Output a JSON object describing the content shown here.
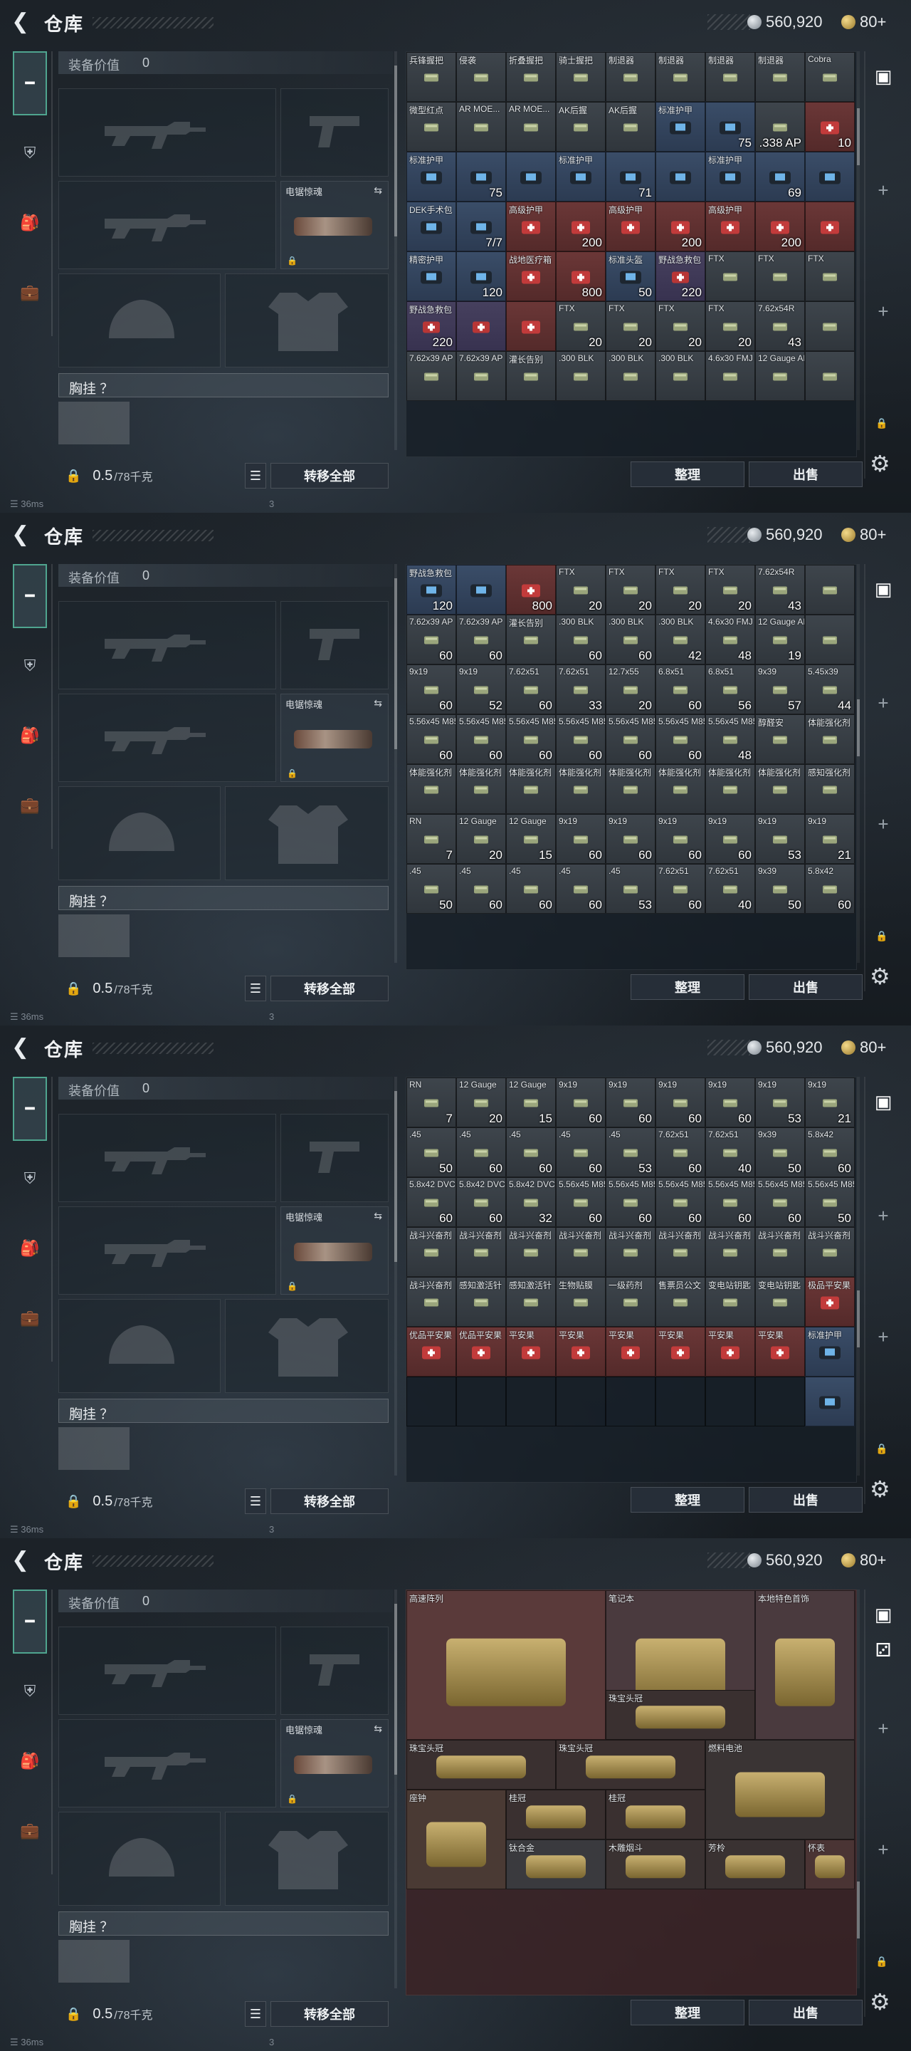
{
  "header": {
    "title": "仓库",
    "coins": "560,920",
    "level": "80+"
  },
  "equipment": {
    "value_label": "装备价值",
    "value": "0",
    "weapon_name": "电锯惊魂",
    "chest_label": "胸挂 ？",
    "weight_value": "0.5",
    "weight_unit": "/78千克",
    "transfer_all": "转移全部"
  },
  "actions": {
    "sort": "整理",
    "sell": "出售"
  },
  "status": {
    "ping": "36ms",
    "extra": "3"
  },
  "colors": {
    "accent": "#4fa58f",
    "rarity_blue": "#3a4d68",
    "rarity_red": "#6b3737",
    "rarity_purple": "#46405e",
    "rarity_gold": "#4b4436"
  },
  "panels": [
    {
      "rows": [
        [
          [
            "兵锋握把",
            "",
            "gray"
          ],
          [
            "侵袭",
            "",
            "gray"
          ],
          [
            "折叠握把",
            "",
            "gray"
          ],
          [
            "骑士握把",
            "",
            "gray"
          ],
          [
            "制退器",
            "",
            "gray"
          ],
          [
            "制退器",
            "",
            "gray"
          ],
          [
            "制退器",
            "",
            "gray"
          ],
          [
            "制退器",
            "",
            "gray"
          ],
          [
            "Cobra",
            "",
            "gray"
          ]
        ],
        [
          [
            "微型红点",
            "",
            "gray"
          ],
          [
            "AR MOE...",
            "",
            "gray"
          ],
          [
            "AR MOE...",
            "",
            "gray"
          ],
          [
            "AK后握",
            "",
            "gray"
          ],
          [
            "AK后握",
            "",
            "gray"
          ],
          [
            "标准护甲",
            "",
            "blue"
          ],
          [
            "",
            "75",
            "blue"
          ],
          [
            "",
            ".338 AP",
            "gray"
          ],
          [
            "",
            "10",
            "red"
          ]
        ],
        [
          [
            "标准护甲",
            "",
            "blue"
          ],
          [
            "",
            "75",
            "blue"
          ],
          [
            "",
            "",
            "blue"
          ],
          [
            "标准护甲",
            "",
            "blue"
          ],
          [
            "",
            "71",
            "blue"
          ],
          [
            "",
            "",
            "blue"
          ],
          [
            "标准护甲",
            "",
            "blue"
          ],
          [
            "",
            "69",
            "blue"
          ],
          [
            "",
            "",
            "blue"
          ]
        ],
        [
          [
            "DEK手术包",
            "",
            "blue"
          ],
          [
            "",
            "7/7",
            "blue"
          ],
          [
            "高级护甲",
            "",
            "red"
          ],
          [
            "",
            "200",
            "red"
          ],
          [
            "高级护甲",
            "",
            "red"
          ],
          [
            "",
            "200",
            "red"
          ],
          [
            "高级护甲",
            "",
            "red"
          ],
          [
            "",
            "200",
            "red"
          ],
          [
            "",
            "",
            "red"
          ]
        ],
        [
          [
            "精密护甲",
            "",
            "blue"
          ],
          [
            "",
            "120",
            "blue"
          ],
          [
            "战地医疗箱",
            "",
            "red"
          ],
          [
            "",
            "800",
            "red"
          ],
          [
            "标准头盔",
            "50",
            "blue"
          ],
          [
            "野战急救包",
            "220",
            "purple"
          ],
          [
            "FTX",
            "",
            "gray"
          ],
          [
            "FTX",
            "",
            "gray"
          ],
          [
            "FTX",
            "",
            "gray"
          ]
        ],
        [
          [
            "野战急救包",
            "220",
            "purple"
          ],
          [
            "",
            "",
            "purple"
          ],
          [
            "",
            "",
            "red"
          ],
          [
            "FTX",
            "20",
            "gray"
          ],
          [
            "FTX",
            "20",
            "gray"
          ],
          [
            "FTX",
            "20",
            "gray"
          ],
          [
            "FTX",
            "20",
            "gray"
          ],
          [
            "7.62x54R",
            "43",
            "gray"
          ],
          [
            "",
            "",
            "gray"
          ]
        ],
        [
          [
            "7.62x39 AP",
            "",
            "gray"
          ],
          [
            "7.62x39 AP",
            "",
            "gray"
          ],
          [
            "灌长告别",
            "",
            "gray"
          ],
          [
            ".300 BLK",
            "",
            "gray"
          ],
          [
            ".300 BLK",
            "",
            "gray"
          ],
          [
            ".300 BLK",
            "",
            "gray"
          ],
          [
            "4.6x30 FMJ",
            "",
            "gray"
          ],
          [
            "12 Gauge AP",
            "",
            "gray"
          ],
          [
            "",
            "",
            "gray"
          ]
        ]
      ]
    },
    {
      "rows": [
        [
          [
            "野战急救包",
            "120",
            "blue"
          ],
          [
            "",
            "",
            "blue"
          ],
          [
            "",
            "800",
            "red"
          ],
          [
            "FTX",
            "20",
            "gray"
          ],
          [
            "FTX",
            "20",
            "gray"
          ],
          [
            "FTX",
            "20",
            "gray"
          ],
          [
            "FTX",
            "20",
            "gray"
          ],
          [
            "7.62x54R",
            "43",
            "gray"
          ],
          [
            "",
            "",
            "gray"
          ]
        ],
        [
          [
            "7.62x39 AP",
            "60",
            "gray"
          ],
          [
            "7.62x39 AP",
            "60",
            "gray"
          ],
          [
            "灌长告别",
            "",
            "gray"
          ],
          [
            ".300 BLK",
            "60",
            "gray"
          ],
          [
            ".300 BLK",
            "60",
            "gray"
          ],
          [
            ".300 BLK",
            "42",
            "gray"
          ],
          [
            "4.6x30 FMJ",
            "48",
            "gray"
          ],
          [
            "12 Gauge AP",
            "19",
            "gray"
          ],
          [
            "",
            "",
            "gray"
          ]
        ],
        [
          [
            "9x19",
            "60",
            "gray"
          ],
          [
            "9x19",
            "52",
            "gray"
          ],
          [
            "7.62x51",
            "60",
            "gray"
          ],
          [
            "7.62x51",
            "33",
            "gray"
          ],
          [
            "12.7x55",
            "20",
            "gray"
          ],
          [
            "6.8x51",
            "60",
            "gray"
          ],
          [
            "6.8x51",
            "56",
            "gray"
          ],
          [
            "9x39",
            "57",
            "gray"
          ],
          [
            "5.45x39",
            "44",
            "gray"
          ]
        ],
        [
          [
            "5.56x45 M855A1",
            "60",
            "gray"
          ],
          [
            "5.56x45 M855A1",
            "60",
            "gray"
          ],
          [
            "5.56x45 M855A1",
            "60",
            "gray"
          ],
          [
            "5.56x45 M855A1",
            "60",
            "gray"
          ],
          [
            "5.56x45 M855A1",
            "60",
            "gray"
          ],
          [
            "5.56x45 M855A1",
            "60",
            "gray"
          ],
          [
            "5.56x45 M855A1",
            "48",
            "gray"
          ],
          [
            "醇醛安",
            "",
            "gray"
          ],
          [
            "体能强化剂",
            "",
            "gray"
          ]
        ],
        [
          [
            "体能强化剂",
            "",
            "gray"
          ],
          [
            "体能强化剂",
            "",
            "gray"
          ],
          [
            "体能强化剂",
            "",
            "gray"
          ],
          [
            "体能强化剂",
            "",
            "gray"
          ],
          [
            "体能强化剂",
            "",
            "gray"
          ],
          [
            "体能强化剂",
            "",
            "gray"
          ],
          [
            "体能强化剂",
            "",
            "gray"
          ],
          [
            "体能强化剂",
            "",
            "gray"
          ],
          [
            "感知强化剂",
            "",
            "gray"
          ]
        ],
        [
          [
            "RN",
            "7",
            "gray"
          ],
          [
            "12 Gauge",
            "20",
            "gray"
          ],
          [
            "12 Gauge",
            "15",
            "gray"
          ],
          [
            "9x19",
            "60",
            "gray"
          ],
          [
            "9x19",
            "60",
            "gray"
          ],
          [
            "9x19",
            "60",
            "gray"
          ],
          [
            "9x19",
            "60",
            "gray"
          ],
          [
            "9x19",
            "53",
            "gray"
          ],
          [
            "9x19",
            "21",
            "gray"
          ]
        ],
        [
          [
            ".45",
            "50",
            "gray"
          ],
          [
            ".45",
            "60",
            "gray"
          ],
          [
            ".45",
            "60",
            "gray"
          ],
          [
            ".45",
            "60",
            "gray"
          ],
          [
            ".45",
            "53",
            "gray"
          ],
          [
            "7.62x51",
            "60",
            "gray"
          ],
          [
            "7.62x51",
            "40",
            "gray"
          ],
          [
            "9x39",
            "50",
            "gray"
          ],
          [
            "5.8x42",
            "60",
            "gray"
          ]
        ]
      ]
    },
    {
      "rows": [
        [
          [
            "RN",
            "7",
            "gray"
          ],
          [
            "12 Gauge",
            "20",
            "gray"
          ],
          [
            "12 Gauge",
            "15",
            "gray"
          ],
          [
            "9x19",
            "60",
            "gray"
          ],
          [
            "9x19",
            "60",
            "gray"
          ],
          [
            "9x19",
            "60",
            "gray"
          ],
          [
            "9x19",
            "60",
            "gray"
          ],
          [
            "9x19",
            "53",
            "gray"
          ],
          [
            "9x19",
            "21",
            "gray"
          ]
        ],
        [
          [
            ".45",
            "50",
            "gray"
          ],
          [
            ".45",
            "60",
            "gray"
          ],
          [
            ".45",
            "60",
            "gray"
          ],
          [
            ".45",
            "60",
            "gray"
          ],
          [
            ".45",
            "53",
            "gray"
          ],
          [
            "7.62x51",
            "60",
            "gray"
          ],
          [
            "7.62x51",
            "40",
            "gray"
          ],
          [
            "9x39",
            "50",
            "gray"
          ],
          [
            "5.8x42",
            "60",
            "gray"
          ]
        ],
        [
          [
            "5.8x42 DVC",
            "60",
            "gray"
          ],
          [
            "5.8x42 DVC",
            "60",
            "gray"
          ],
          [
            "5.8x42 DVC",
            "32",
            "gray"
          ],
          [
            "5.56x45 M855",
            "60",
            "gray"
          ],
          [
            "5.56x45 M855",
            "60",
            "gray"
          ],
          [
            "5.56x45 M855",
            "60",
            "gray"
          ],
          [
            "5.56x45 M855",
            "60",
            "gray"
          ],
          [
            "5.56x45 M855",
            "60",
            "gray"
          ],
          [
            "5.56x45 M855",
            "50",
            "gray"
          ]
        ],
        [
          [
            "战斗兴奋剂",
            "",
            "gray"
          ],
          [
            "战斗兴奋剂",
            "",
            "gray"
          ],
          [
            "战斗兴奋剂",
            "",
            "gray"
          ],
          [
            "战斗兴奋剂",
            "",
            "gray"
          ],
          [
            "战斗兴奋剂",
            "",
            "gray"
          ],
          [
            "战斗兴奋剂",
            "",
            "gray"
          ],
          [
            "战斗兴奋剂",
            "",
            "gray"
          ],
          [
            "战斗兴奋剂",
            "",
            "gray"
          ],
          [
            "战斗兴奋剂",
            "",
            "gray"
          ]
        ],
        [
          [
            "战斗兴奋剂",
            "",
            "gray"
          ],
          [
            "感知激活针",
            "",
            "gray"
          ],
          [
            "感知激活针",
            "",
            "gray"
          ],
          [
            "生物贴膜",
            "",
            "gray"
          ],
          [
            "一级药剂",
            "",
            "gray"
          ],
          [
            "售票员公文",
            "",
            "gray"
          ],
          [
            "变电站钥匙",
            "",
            "gray"
          ],
          [
            "变电站钥匙",
            "",
            "gray"
          ],
          [
            "极品平安果",
            "",
            "red"
          ]
        ],
        [
          [
            "优品平安果",
            "",
            "red"
          ],
          [
            "优品平安果",
            "",
            "red"
          ],
          [
            "平安果",
            "",
            "red"
          ],
          [
            "平安果",
            "",
            "red"
          ],
          [
            "平安果",
            "",
            "red"
          ],
          [
            "平安果",
            "",
            "red"
          ],
          [
            "平安果",
            "",
            "red"
          ],
          [
            "平安果",
            "",
            "red"
          ],
          [
            "标准护甲",
            "",
            "blue"
          ]
        ],
        [
          [
            "",
            "",
            "empty"
          ],
          [
            "",
            "",
            "empty"
          ],
          [
            "",
            "",
            "empty"
          ],
          [
            "",
            "",
            "empty"
          ],
          [
            "",
            "",
            "empty"
          ],
          [
            "",
            "",
            "empty"
          ],
          [
            "",
            "",
            "empty"
          ],
          [
            "",
            "",
            "empty"
          ],
          [
            "",
            "",
            "blue"
          ]
        ]
      ]
    },
    {
      "rows": []
    }
  ],
  "valuables": {
    "server": "高速阵列",
    "laptop": "笔记本",
    "necklace": "本地特色首饰",
    "crown1": "珠宝头冠",
    "crown2": "珠宝头冠",
    "crown3": "珠宝头冠",
    "battery": "燃料电池",
    "clock": "座钟",
    "bracelet1": "桂冠",
    "bracelet2": "桂冠",
    "ingot": "钛合金",
    "pipe": "木雕烟斗",
    "scroll": "芳柃",
    "watch": "怀表"
  }
}
